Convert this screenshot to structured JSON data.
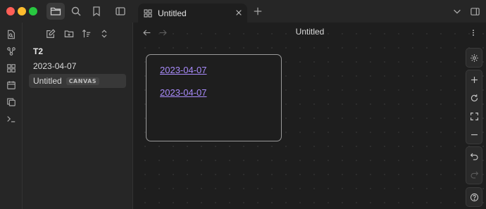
{
  "window": {
    "tab_title": "Untitled"
  },
  "sidebar": {
    "items": [
      {
        "label": "T2",
        "type": "folder"
      },
      {
        "label": "2023-04-07",
        "type": "file"
      },
      {
        "label": "Untitled",
        "badge": "CANVAS",
        "type": "file",
        "active": true
      }
    ]
  },
  "main": {
    "title": "Untitled",
    "card": {
      "links": [
        "2023-04-07",
        "2023-04-07"
      ]
    }
  },
  "colors": {
    "accent": "#a88bfa",
    "background": "#1e1e1e",
    "sidebar": "#262626"
  },
  "icons": [
    "folder-icon",
    "search-icon",
    "bookmark-icon",
    "sidebar-toggle-icon",
    "canvas-icon",
    "close-icon",
    "plus-icon",
    "chevron-down-icon",
    "layout-icon",
    "file-switcher-icon",
    "graph-icon",
    "canvas-icon",
    "calendar-icon",
    "copy-icon",
    "terminal-icon",
    "new-note-icon",
    "new-folder-icon",
    "sort-icon",
    "expand-collapse-icon",
    "arrow-left-icon",
    "arrow-right-icon",
    "more-icon",
    "settings-icon",
    "zoom-in-icon",
    "reset-icon",
    "fit-icon",
    "zoom-out-icon",
    "undo-icon",
    "redo-icon",
    "help-icon"
  ]
}
